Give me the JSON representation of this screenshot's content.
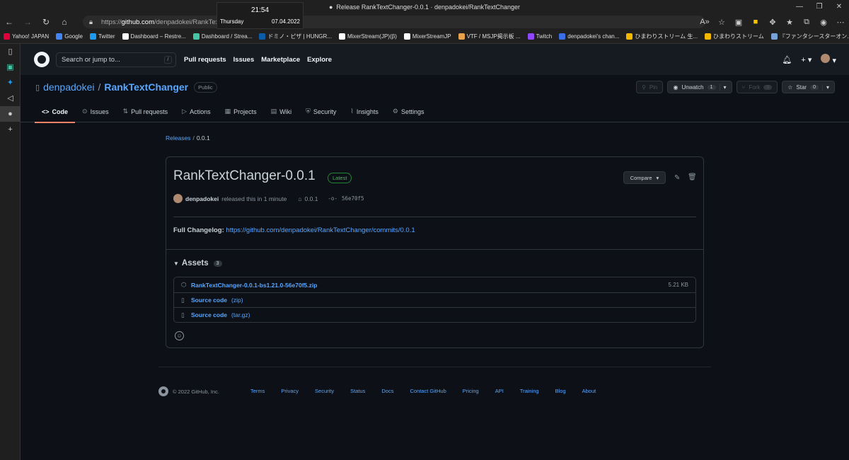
{
  "browser": {
    "window_title": "Release RankTextChanger-0.0.1 · denpadokei/RankTextChanger",
    "url_prefix": "https://",
    "url_host": "github.com",
    "url_path": "/denpadokei/RankTextChanger/releases/tag/0.0.1",
    "clock": {
      "time": "21:54",
      "day": "Thursday",
      "date": "07.04.2022"
    },
    "bookmarks": [
      {
        "label": "Yahoo! JAPAN",
        "color": "#e0003c"
      },
      {
        "label": "Google",
        "color": "#4285f4"
      },
      {
        "label": "Twitter",
        "color": "#1d9bf0"
      },
      {
        "label": "Dashboard – Restre...",
        "color": "#ffffff"
      },
      {
        "label": "Dashboard / Strea...",
        "color": "#45c3a4"
      },
      {
        "label": "ドミノ・ピザ | HUNGR...",
        "color": "#0b5ca8"
      },
      {
        "label": "MixerStream(JP)(β)",
        "color": "#ffffff"
      },
      {
        "label": "MixerStreamJP",
        "color": "#ffffff"
      },
      {
        "label": "VTF / MSJP掲示板 ...",
        "color": "#e8a34a"
      },
      {
        "label": "Twitch",
        "color": "#9146ff"
      },
      {
        "label": "denpadokei's chan...",
        "color": "#3a6ee8"
      },
      {
        "label": "ひまわりストリーム 生...",
        "color": "#f5b800"
      },
      {
        "label": "ひまわりストリーム",
        "color": "#f5b800"
      },
      {
        "label": "『ファンタシースターオン...",
        "color": "#7aa0d8"
      }
    ]
  },
  "github": {
    "search_placeholder": "Search or jump to...",
    "search_key": "/",
    "nav": [
      "Pull requests",
      "Issues",
      "Marketplace",
      "Explore"
    ],
    "owner": "denpadokei",
    "repo": "RankTextChanger",
    "visibility": "Public",
    "buttons": {
      "pin": "Pin",
      "unwatch": "Unwatch",
      "unwatch_count": "1",
      "fork": "Fork",
      "fork_count": "0",
      "star": "Star",
      "star_count": "0"
    },
    "tabs": [
      "Code",
      "Issues",
      "Pull requests",
      "Actions",
      "Projects",
      "Wiki",
      "Security",
      "Insights",
      "Settings"
    ]
  },
  "breadcrumb": {
    "parent": "Releases",
    "current": "0.0.1"
  },
  "release": {
    "title": "RankTextChanger-0.0.1",
    "badge": "Latest",
    "compare": "Compare",
    "author": "denpadokei",
    "released_text": "released this in 1 minute",
    "tag": "0.0.1",
    "commit": "56e70f5",
    "changelog_label": "Full Changelog",
    "changelog_url": "https://github.com/denpadokei/RankTextChanger/commits/0.0.1",
    "assets_label": "Assets",
    "assets_count": "3",
    "assets": [
      {
        "name": "RankTextChanger-0.0.1-bs1.21.0-56e70f5.zip",
        "sub": "",
        "size": "5.21 KB"
      },
      {
        "name": "Source code",
        "sub": "(zip)",
        "size": ""
      },
      {
        "name": "Source code",
        "sub": "(tar.gz)",
        "size": ""
      }
    ]
  },
  "footer": {
    "copyright": "© 2022 GitHub, Inc.",
    "links": [
      "Terms",
      "Privacy",
      "Security",
      "Status",
      "Docs",
      "Contact GitHub",
      "Pricing",
      "API",
      "Training",
      "Blog",
      "About"
    ]
  }
}
